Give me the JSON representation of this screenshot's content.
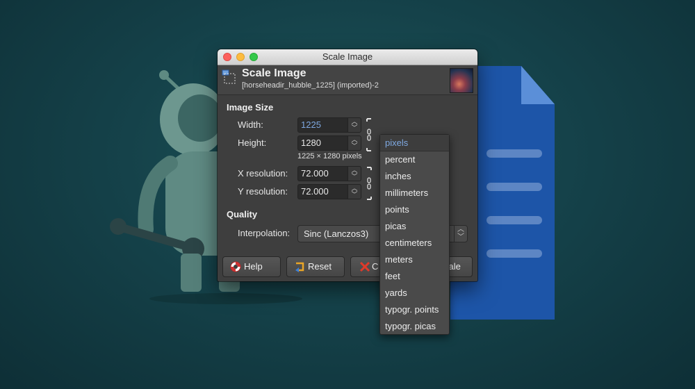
{
  "window": {
    "title": "Scale Image"
  },
  "header": {
    "title": "Scale Image",
    "subtitle": "[horseheadir_hubble_1225] (imported)-2"
  },
  "image_size": {
    "section_label": "Image Size",
    "width_label": "Width:",
    "width_value": "1225",
    "height_label": "Height:",
    "height_value": "1280",
    "size_info": "1225 × 1280 pixels",
    "xres_label": "X resolution:",
    "xres_value": "72.000",
    "yres_label": "Y resolution:",
    "yres_value": "72.000"
  },
  "quality": {
    "section_label": "Quality",
    "interpolation_label": "Interpolation:",
    "interpolation_value": "Sinc (Lanczos3)"
  },
  "buttons": {
    "help": "Help",
    "reset": "Reset",
    "cancel": "C",
    "scale": "cale"
  },
  "unit_menu": {
    "selected": "pixels",
    "items": [
      "pixels",
      "percent",
      "inches",
      "millimeters",
      "points",
      "picas",
      "centimeters",
      "meters",
      "feet",
      "yards",
      "typogr. points",
      "typogr. picas"
    ]
  },
  "colors": {
    "background": "#15424a",
    "dialog": "#3e3e3e",
    "selection_text": "#7fa9e2"
  }
}
